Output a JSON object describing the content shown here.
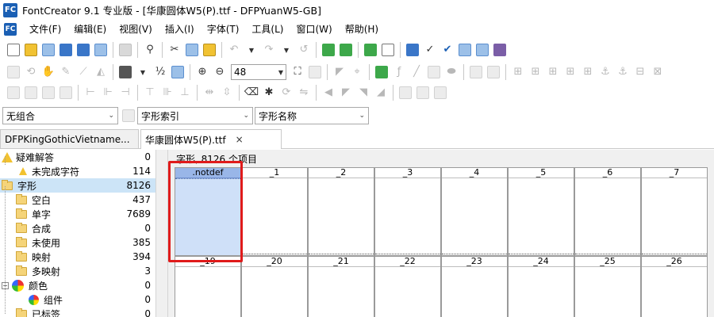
{
  "window": {
    "app_icon_text": "FC",
    "title": "FontCreator 9.1 专业版  - [华康圆体W5(P).ttf - DFPYuanW5-GB]"
  },
  "menu": {
    "items": [
      "文件(F)",
      "编辑(E)",
      "视图(V)",
      "插入(I)",
      "字体(T)",
      "工具(L)",
      "窗口(W)",
      "帮助(H)"
    ]
  },
  "toolbar": {
    "zoom_value": "48"
  },
  "combos": {
    "group_value": "无组合",
    "index_value": "字形索引",
    "name_value": "字形名称"
  },
  "tabs": [
    {
      "label": "DFPKingGothicVietname..."
    },
    {
      "label": "华康圆体W5(P).ttf",
      "close": "×"
    }
  ],
  "tree": {
    "items": [
      {
        "label": "疑难解答",
        "count": "0"
      },
      {
        "label": "未完成字符",
        "count": "114"
      },
      {
        "label": "字形",
        "count": "8126"
      },
      {
        "label": "空白",
        "count": "437"
      },
      {
        "label": "单字",
        "count": "7689"
      },
      {
        "label": "合成",
        "count": "0"
      },
      {
        "label": "未使用",
        "count": "385"
      },
      {
        "label": "映射",
        "count": "394"
      },
      {
        "label": "多映射",
        "count": "3"
      },
      {
        "label": "颜色",
        "count": "0"
      },
      {
        "label": "组件",
        "count": "0"
      },
      {
        "label": "已标签",
        "count": "0"
      }
    ]
  },
  "grid": {
    "status": "字形, 8126 个项目",
    "row1": [
      ".notdef",
      "_1",
      "_2",
      "_3",
      "_4",
      "_5",
      "_6",
      "_7"
    ],
    "row2": [
      "_19",
      "_20",
      "_21",
      "_22",
      "_23",
      "_24",
      "_25",
      "_26"
    ]
  },
  "colors": {
    "selection_header": "#99b6e8",
    "selection_body": "#cfe0f8",
    "highlight_border": "#e01b1b",
    "tree_selected": "#cce4f7"
  }
}
